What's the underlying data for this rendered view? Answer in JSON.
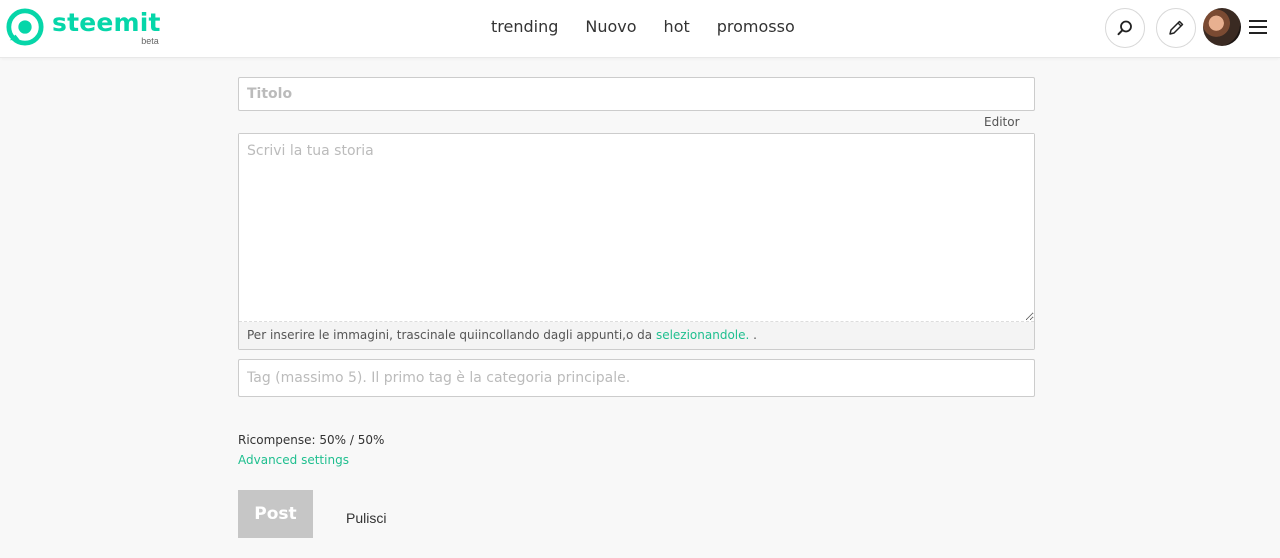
{
  "header": {
    "logo_text": "steemit",
    "logo_badge": "beta",
    "nav": [
      {
        "label": "trending"
      },
      {
        "label": "Nuovo"
      },
      {
        "label": "hot"
      },
      {
        "label": "promosso"
      }
    ],
    "icons": {
      "search": "search-icon",
      "pencil": "pencil-icon",
      "menu": "hamburger-menu-icon"
    },
    "brand_color": "#06d6a9"
  },
  "editor": {
    "title_placeholder": "Titolo",
    "editor_toggle_label": "Editor",
    "body_placeholder": "Scrivi la tua storia",
    "image_hint_prefix": "Per inserire le immagini, trascinale quiincollando dagli appunti,o da ",
    "image_hint_link": "selezionandole.",
    "image_hint_suffix": " .",
    "tags_placeholder": "Tag (massimo 5). Il primo tag è la categoria principale.",
    "rewards_text": "Ricompense: 50% / 50%",
    "advanced_settings_label": "Advanced settings",
    "post_button_label": "Post",
    "clear_button_label": "Pulisci",
    "link_color": "#1fbf8f"
  }
}
